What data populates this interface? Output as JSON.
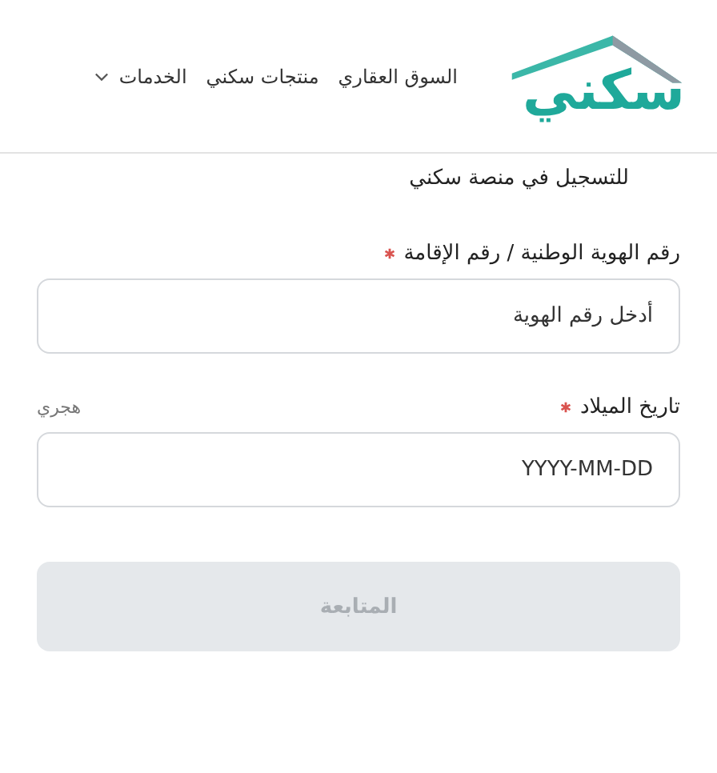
{
  "header": {
    "logo": "سكني",
    "nav": [
      {
        "label": "السوق العقاري",
        "dropdown": false
      },
      {
        "label": "منتجات سكني",
        "dropdown": false
      },
      {
        "label": "الخدمات",
        "dropdown": true
      }
    ]
  },
  "form": {
    "subtitle": "للتسجيل في منصة سكني",
    "fields": [
      {
        "label": "رقم الهوية الوطنية / رقم الإقامة",
        "required": true,
        "placeholder": "أدخل رقم الهوية"
      },
      {
        "label": "تاريخ الميلاد",
        "required": true,
        "placeholder": "YYYY-MM-DD",
        "toggle": "هجري"
      }
    ],
    "submit": {
      "label": "المتابعة",
      "disabled": true
    }
  }
}
